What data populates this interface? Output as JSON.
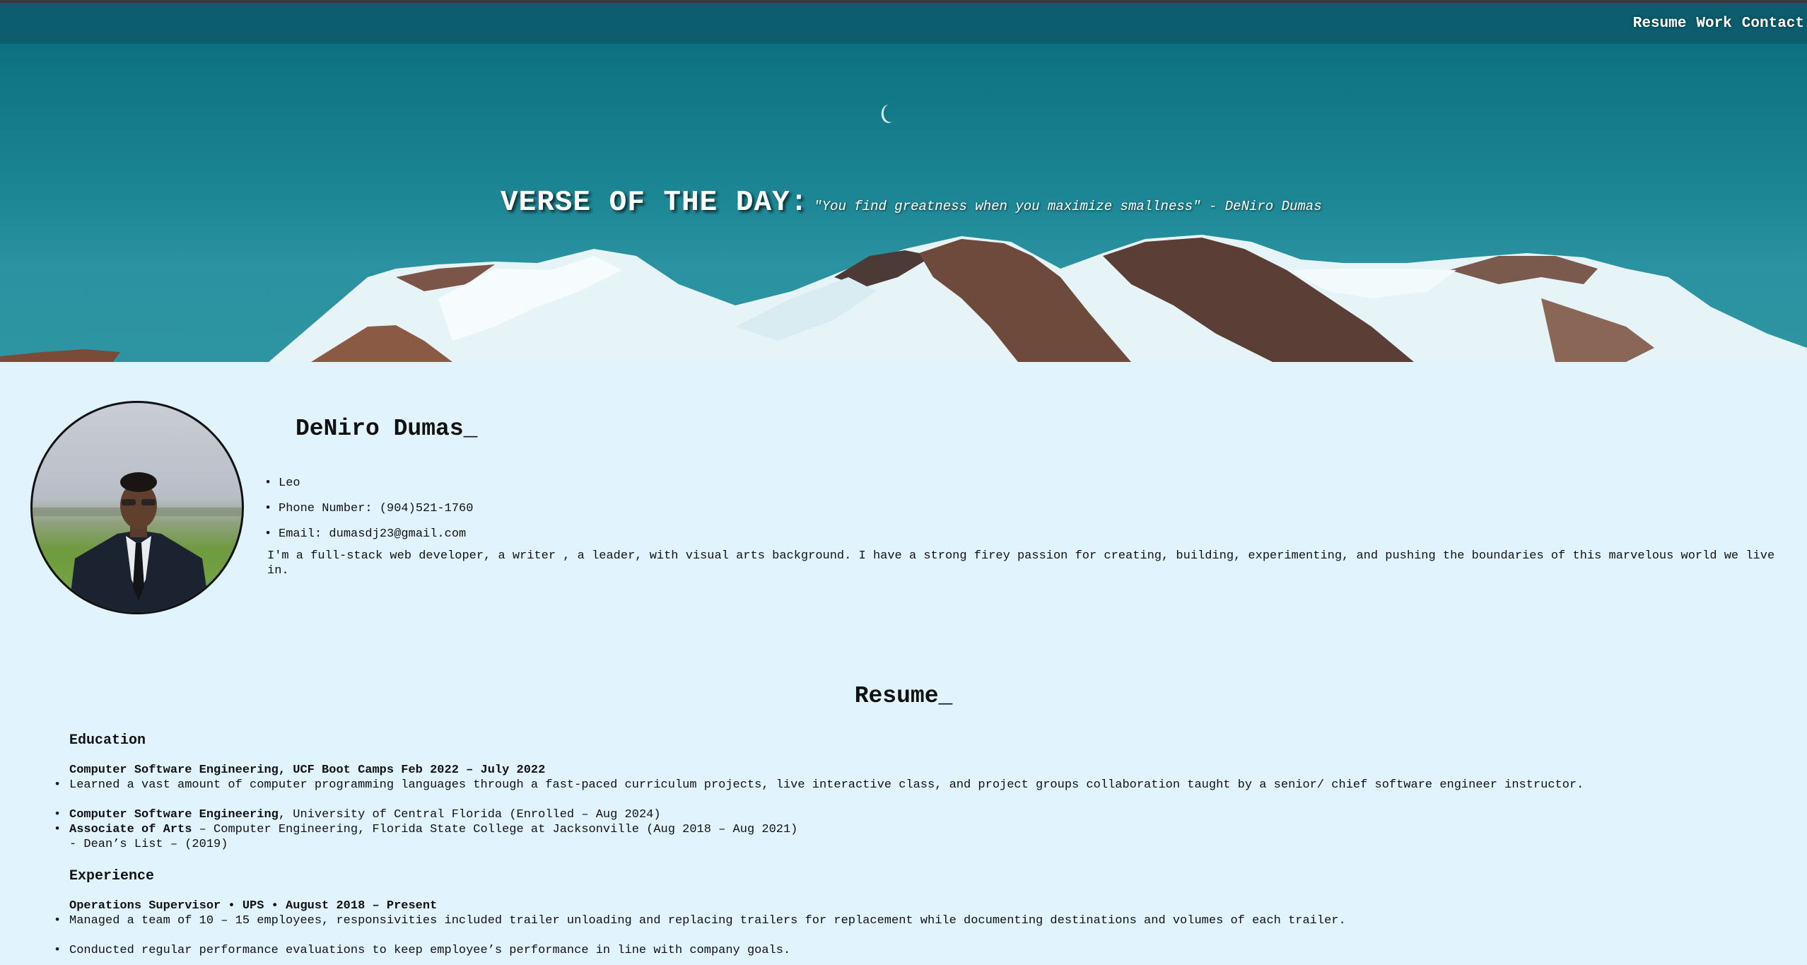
{
  "nav": {
    "items": [
      "Resume",
      "Work",
      "Contact"
    ]
  },
  "hero": {
    "verse_label": "VERSE OF THE DAY:",
    "verse_text": "\"You find greatness when you maximize smallness\" - DeNiro Dumas"
  },
  "profile": {
    "name": "DeNiro Dumas_",
    "sign": "Leo",
    "phone": "Phone Number: (904)521-1760",
    "email": "Email: dumasdj23@gmail.com",
    "bio": "I'm a full-stack web developer, a writer , a leader, with visual arts background. I have a strong firey passion for creating, building, experimenting, and pushing the boundaries of this marvelous world we live in."
  },
  "resume": {
    "title": "Resume_",
    "education": {
      "heading": "Education",
      "bootcamp_title": "Computer Software Engineering, UCF Boot Camps Feb 2022 – July 2022",
      "bootcamp_desc": "Learned a vast amount of computer programming languages through a fast-paced curriculum projects, live interactive class, and project groups collaboration taught by a senior/ chief software engineer instructor.",
      "ucf_bold": "Computer Software Engineering",
      "ucf_rest": ", University of Central Florida (Enrolled – Aug 2024)",
      "fscj_bold": "Associate of Arts",
      "fscj_rest": " – Computer Engineering, Florida State College at Jacksonville (Aug 2018 – Aug 2021)",
      "deans_list": "- Dean’s List – (2019)"
    },
    "experience": {
      "heading": "Experience",
      "job_title": "Operations Supervisor • UPS • August 2018 – Present",
      "bullets": [
        "Managed a team of 10 – 15 employees, responsivities included trailer unloading and replacing trailers for replacement while documenting destinations and volumes of each trailer.",
        "Conducted regular performance evaluations to keep employee’s performance in line with company goals."
      ]
    }
  },
  "colors": {
    "nav_bg": "#0c5d6e",
    "page_bg": "#e1f3fd",
    "sky": "#1b8593"
  }
}
